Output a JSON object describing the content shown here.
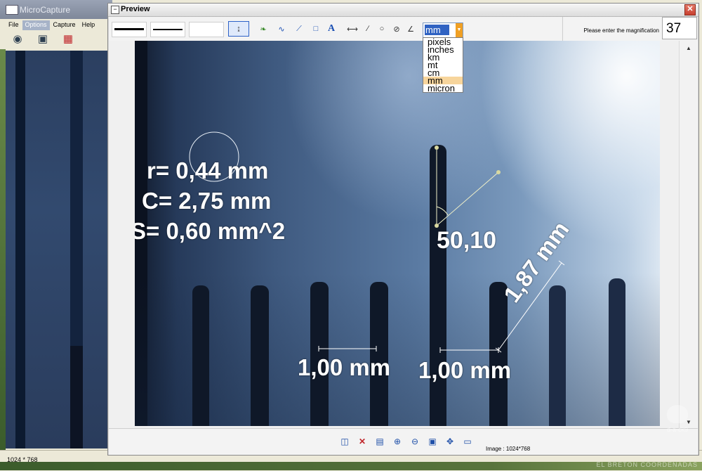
{
  "main_window": {
    "title": "MicroCapture",
    "menu": [
      "File",
      "Options",
      "Capture",
      "Help"
    ],
    "active_menu": "Options",
    "toolbar_icons": [
      "camera-icon",
      "video-camera-icon",
      "fullscreen-icon"
    ],
    "status_resolution": "1024 * 768"
  },
  "preview": {
    "title": "Preview",
    "close_symbol": "✕",
    "tools": [
      "select-tool-icon",
      "freehand-tool-icon",
      "curve-tool-icon",
      "line-tool-icon",
      "rectangle-tool-icon",
      "text-tool-icon",
      "measure-distance-icon",
      "measure-polyline-icon",
      "measure-circle-icon",
      "measure-diameter-icon",
      "measure-angle-icon"
    ],
    "unit_select": {
      "selected": "mm",
      "options": [
        "pixels",
        "inches",
        "km",
        "mt",
        "cm",
        "mm",
        "micron"
      ]
    },
    "magnification": {
      "label": "Please enter the magnification",
      "value": "37"
    },
    "measurements": {
      "circle_radius": "r= 0,44 mm",
      "circle_circumference": "C= 2,75 mm",
      "circle_area": "S= 0,60 mm^2",
      "angle": "50,10",
      "distance_1": "1,00 mm",
      "distance_2": "1,00 mm",
      "diagonal": "1,87 mm"
    },
    "bottom_icons": [
      "save-icon",
      "delete-icon",
      "paste-icon",
      "zoom-in-icon",
      "zoom-out-icon",
      "fit-screen-icon",
      "move-icon",
      "export-icon"
    ],
    "image_info": "Image : 1024*768"
  },
  "watermark": {
    "name": "d-a-ck9",
    "signature": "EL BRETON COORDENADAS"
  }
}
